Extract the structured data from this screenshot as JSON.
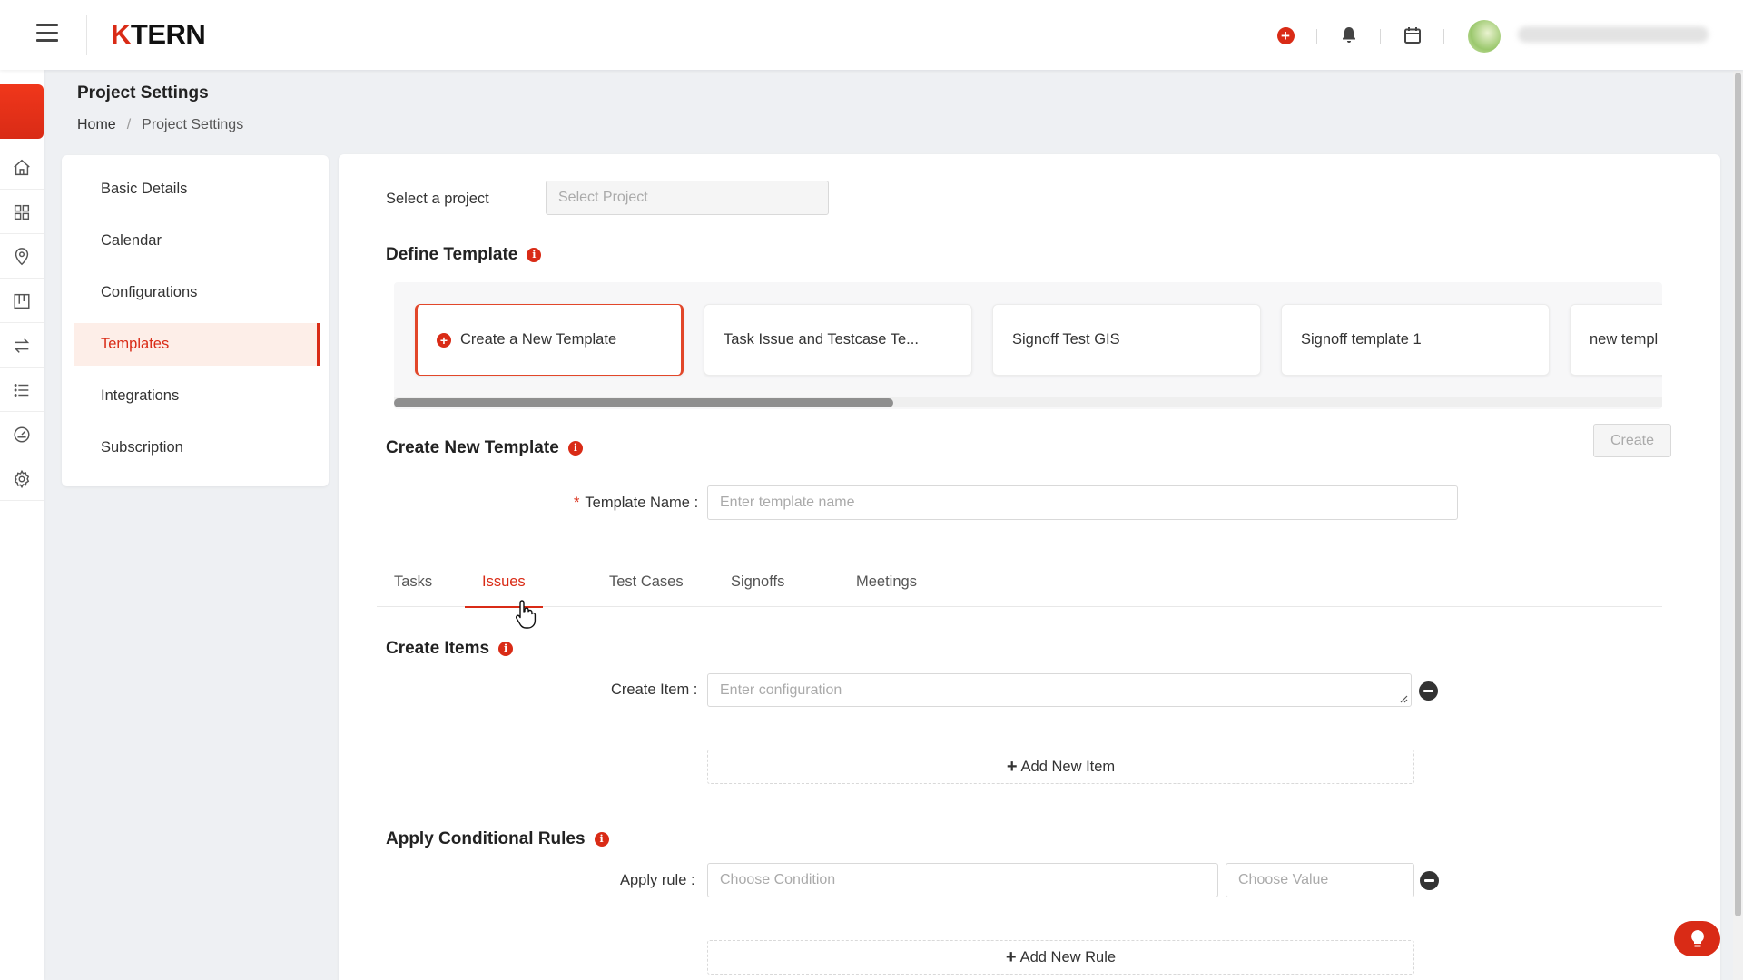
{
  "app": {
    "logo_k": "K",
    "logo_rest": "TERN"
  },
  "header": {
    "title": "Project Settings",
    "breadcrumb": [
      "Home",
      "Project Settings"
    ]
  },
  "settings_nav": {
    "items": [
      {
        "label": "Basic Details"
      },
      {
        "label": "Calendar"
      },
      {
        "label": "Configurations"
      },
      {
        "label": "Templates",
        "active": true
      },
      {
        "label": "Integrations"
      },
      {
        "label": "Subscription"
      }
    ]
  },
  "project_select": {
    "label": "Select a project",
    "placeholder": "Select Project"
  },
  "define_template": {
    "heading": "Define Template",
    "cards": [
      {
        "label": "Create a New Template"
      },
      {
        "label": "Task Issue and Testcase Te..."
      },
      {
        "label": "Signoff Test GIS"
      },
      {
        "label": "Signoff template 1"
      },
      {
        "label": "new templ"
      }
    ]
  },
  "create_template": {
    "heading": "Create New Template",
    "create_button": "Create",
    "name_label": "Template Name",
    "name_placeholder": "Enter template name"
  },
  "tabs": [
    {
      "label": "Tasks"
    },
    {
      "label": "Issues",
      "active": true
    },
    {
      "label": "Test Cases"
    },
    {
      "label": "Signoffs"
    },
    {
      "label": "Meetings"
    }
  ],
  "create_items": {
    "heading": "Create Items",
    "item_label": "Create Item",
    "item_placeholder": "Enter configuration",
    "add_button": "Add New Item"
  },
  "conditional_rules": {
    "heading": "Apply Conditional Rules",
    "rule_label": "Apply rule",
    "condition_placeholder": "Choose Condition",
    "value_placeholder": "Choose Value",
    "add_button": "Add New Rule"
  },
  "colors": {
    "accent": "#d92b16",
    "active_bg": "#fdeee8"
  }
}
